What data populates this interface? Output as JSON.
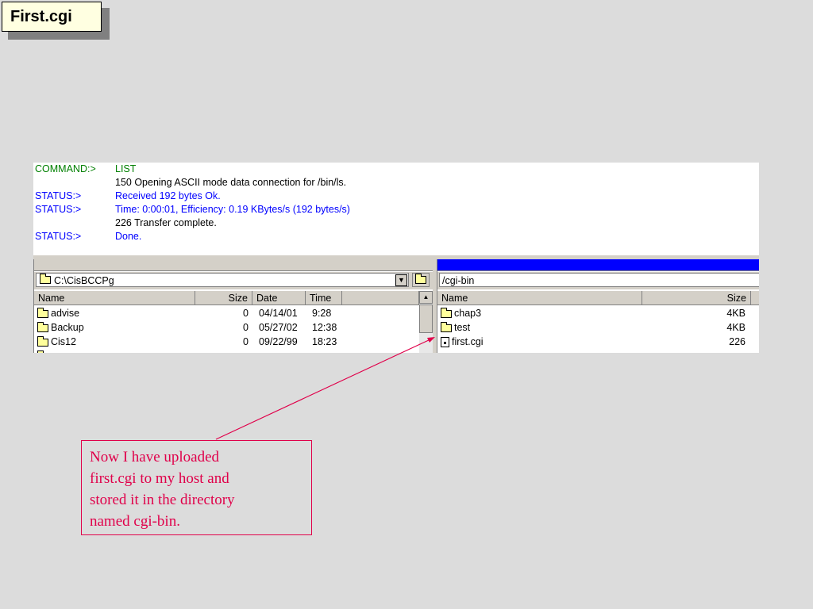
{
  "slide": {
    "title": "First.cgi"
  },
  "log": [
    {
      "label": "COMMAND:>",
      "text": "LIST",
      "color": "green"
    },
    {
      "label": "",
      "text": "150 Opening ASCII mode data connection for /bin/ls.",
      "color": "black"
    },
    {
      "label": "STATUS:>",
      "text": "Received 192 bytes Ok.",
      "color": "blue"
    },
    {
      "label": "STATUS:>",
      "text": "Time: 0:00:01, Efficiency: 0.19 KBytes/s (192 bytes/s)",
      "color": "blue"
    },
    {
      "label": "",
      "text": "226 Transfer complete.",
      "color": "black"
    },
    {
      "label": "STATUS:>",
      "text": "Done.",
      "color": "blue"
    }
  ],
  "local": {
    "path": "C:\\CisBCCPg",
    "columns": {
      "name": "Name",
      "size": "Size",
      "date": "Date",
      "time": "Time"
    },
    "rows": [
      {
        "name": "advise",
        "size": "0",
        "date": "04/14/01",
        "time": "9:28"
      },
      {
        "name": "Backup",
        "size": "0",
        "date": "05/27/02",
        "time": "12:38"
      },
      {
        "name": "Cis12",
        "size": "0",
        "date": "09/22/99",
        "time": "18:23"
      }
    ]
  },
  "remote": {
    "path": "/cgi-bin",
    "columns": {
      "name": "Name",
      "size": "Size"
    },
    "rows": [
      {
        "name": "chap3",
        "size": "4KB",
        "type": "folder"
      },
      {
        "name": "test",
        "size": "4KB",
        "type": "folder"
      },
      {
        "name": "first.cgi",
        "size": "226",
        "type": "file"
      }
    ]
  },
  "callout": {
    "lines": [
      "Now I have uploaded",
      "first.cgi to my host and",
      "stored it in the directory",
      "named cgi-bin."
    ]
  },
  "colors": {
    "callout": "#e0004a",
    "active_header": "#0000ff",
    "command": "#008000",
    "status": "#0000ff"
  }
}
